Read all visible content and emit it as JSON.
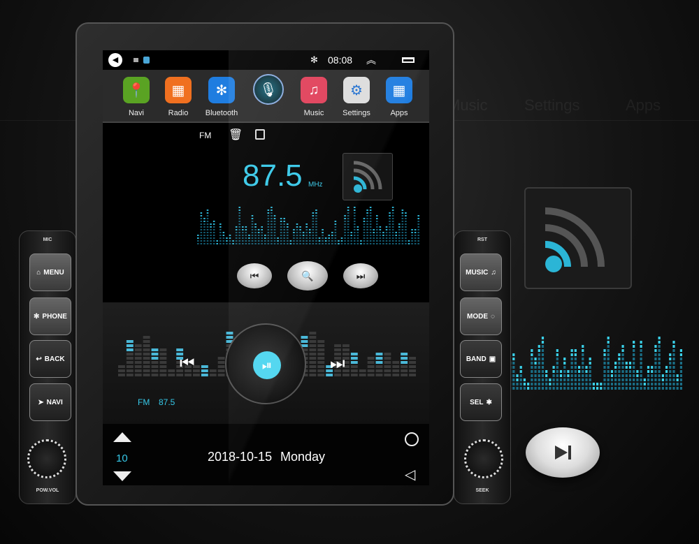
{
  "background": {
    "ghost_labels": [
      "Music",
      "Settings",
      "Apps"
    ]
  },
  "status_bar": {
    "time": "08:08",
    "icons": [
      "back-circle-icon",
      "image-icon",
      "notification-icon",
      "bluetooth-icon",
      "expand-up-icon",
      "recent-apps-icon"
    ]
  },
  "dock": {
    "apps": [
      {
        "label": "Navi",
        "icon": "map-pin-icon",
        "color": "#5aa323"
      },
      {
        "label": "Radio",
        "icon": "radio-icon",
        "color": "#f07020"
      },
      {
        "label": "Bluetooth",
        "icon": "bluetooth-icon",
        "color": "#1f7de0"
      },
      {
        "label": "",
        "icon": "microphone-icon",
        "color": "#1ccbe8"
      },
      {
        "label": "Music",
        "icon": "music-note-icon",
        "color": "#e0405a"
      },
      {
        "label": "Settings",
        "icon": "gear-icon",
        "color": "#dddddd"
      },
      {
        "label": "Apps",
        "icon": "grid-icon",
        "color": "#1f7de0"
      }
    ]
  },
  "radio": {
    "band": "FM",
    "frequency": "87.5",
    "unit": "MHz"
  },
  "music_widget": {
    "band": "FM",
    "frequency": "87.5"
  },
  "bottom_bar": {
    "volume": "10",
    "date": "2018-10-15",
    "day": "Monday"
  },
  "left_panel": {
    "top_label": "MIC",
    "buttons": [
      "MENU",
      "PHONE",
      "BACK",
      "NAVI"
    ],
    "knob_label": "POW.VOL"
  },
  "right_panel": {
    "top_label": "RST",
    "buttons": [
      "MUSIC",
      "MODE",
      "BAND",
      "SEL"
    ],
    "knob_label": "SEEK"
  },
  "colors": {
    "accent": "#36c8e8"
  }
}
